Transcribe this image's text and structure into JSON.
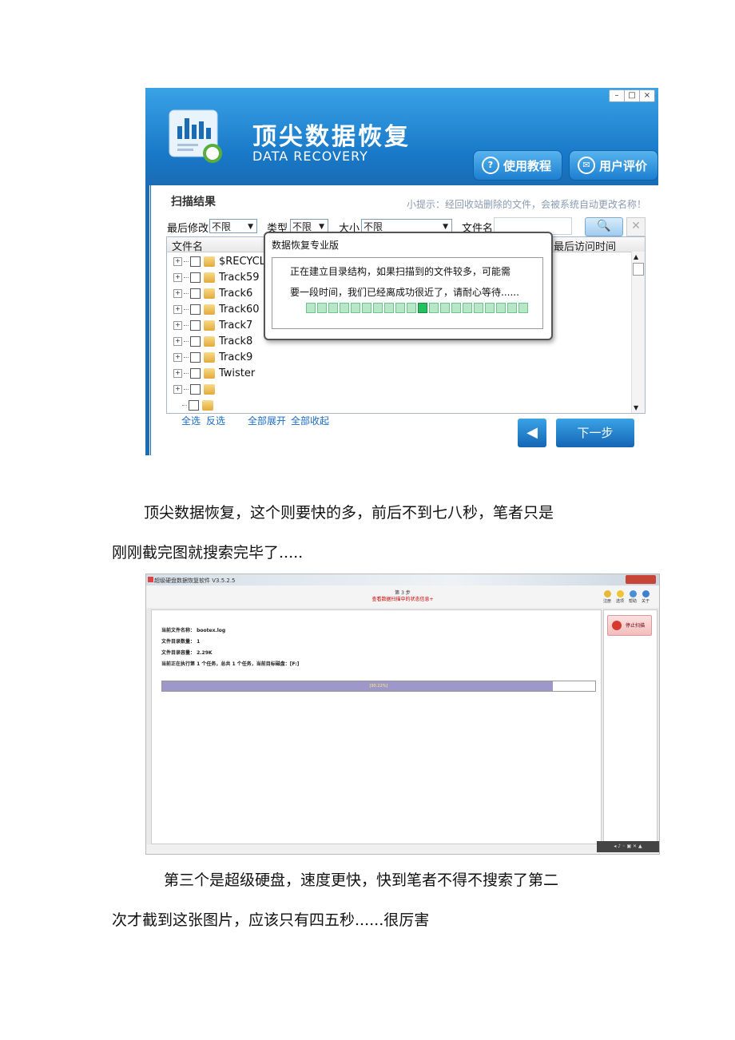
{
  "shot1": {
    "window_controls": [
      "–",
      "□",
      "×"
    ],
    "app_title": "顶尖数据恢复",
    "app_subtitle": "DATA RECOVERY",
    "btn_tutorial": "使用教程",
    "btn_review": "用户评价",
    "section_title": "扫描结果",
    "tip": "小提示：经回收站删除的文件，会被系统自动更改名称！",
    "filters": {
      "modified_label": "最后修改",
      "modified_value": "不限",
      "type_label": "类型",
      "type_value": "不限",
      "size_label": "大小",
      "size_value": "不限",
      "filename_label": "文件名"
    },
    "table": {
      "col_name": "文件名",
      "col_last_access": "最后访问时间",
      "rows": [
        {
          "name": "$RECYCLE."
        },
        {
          "name": "Track59"
        },
        {
          "name": "Track6"
        },
        {
          "name": "Track60"
        },
        {
          "name": "Track7"
        },
        {
          "name": "Track8"
        },
        {
          "name": "Track9"
        },
        {
          "name": "Twister"
        },
        {
          "name": ""
        },
        {
          "name": ""
        }
      ]
    },
    "links": {
      "select_all": "全选",
      "invert": "反选",
      "expand_all": "全部展开",
      "collapse_all": "全部收起"
    },
    "next_button": "下一步",
    "dialog": {
      "title": "数据恢复专业版",
      "line1": "正在建立目录结构，如果扫描到的文件较多，可能需",
      "line2": "要一段时间，我们已经离成功很近了，请耐心等待......",
      "progress_blocks": 20,
      "active_block": 10
    }
  },
  "paragraph1_line1": "顶尖数据恢复，这个则要快的多，前后不到七八秒，笔者只是",
  "paragraph1_line2": "刚刚截完图就搜索完毕了.....",
  "shot2": {
    "app_title": "超级硬盘数据恢复软件 V3.5.2.5",
    "step": "第 3 步",
    "step_sub": "查看数据扫描中的状态信息+",
    "toolbar": [
      "注册",
      "选项",
      "帮助",
      "关于"
    ],
    "stop_button": "停止扫描",
    "info": {
      "current_file": "当前文件名称：  bootex.log",
      "dir_count": "文件目录数量：  1",
      "dir_size": "文件目录容量：  2.29K",
      "task": "当前正在执行第 1 个任务，总共 1 个任务，当前目标磁盘：[F:]"
    },
    "progress_percent": 90.22,
    "progress_text": "[90.22%]"
  },
  "paragraph2_line1": "第三个是超级硬盘，速度更快，快到笔者不得不搜索了第二",
  "paragraph2_line2": "次才截到这张图片，应该只有四五秒......很厉害"
}
